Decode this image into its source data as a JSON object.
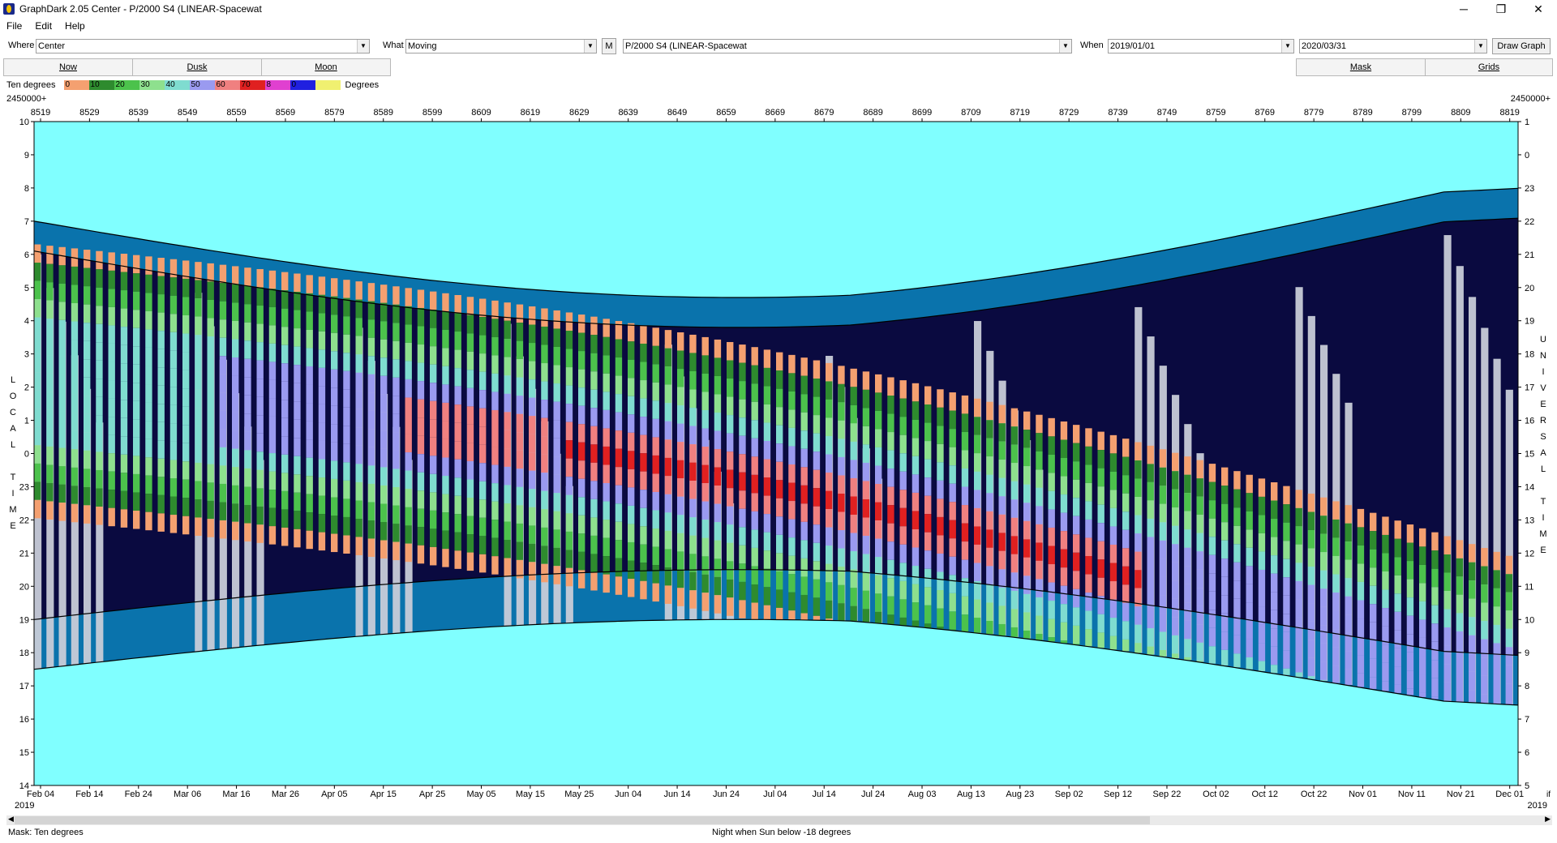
{
  "window": {
    "title": "GraphDark 2.05  Center  -  P/2000 S4 (LINEAR-Spacewat",
    "minimize": "─",
    "maximize": "❐",
    "close": "✕"
  },
  "menu": [
    "File",
    "Edit",
    "Help"
  ],
  "toolbar": {
    "where_label": "Where",
    "where_value": "Center",
    "what_label": "What",
    "what_value": "Moving",
    "m_button": "M",
    "object_value": "P/2000 S4 (LINEAR-Spacewat",
    "when_label": "When",
    "start_date": "2019/01/01",
    "end_date": "2020/03/31",
    "draw_button": "Draw Graph"
  },
  "buttons": {
    "now": "Now",
    "dusk": "Dusk",
    "moon": "Moon",
    "mask": "Mask",
    "grids": "Grids"
  },
  "legend": {
    "title": "Ten degrees",
    "units": "Degrees",
    "entries": [
      {
        "label": "0",
        "color": "#f4a070"
      },
      {
        "label": "10",
        "color": "#2e8b2e"
      },
      {
        "label": "20",
        "color": "#4cc24c"
      },
      {
        "label": "30",
        "color": "#8ee08e"
      },
      {
        "label": "40",
        "color": "#7fdcd0"
      },
      {
        "label": "50",
        "color": "#9a9af0"
      },
      {
        "label": "60",
        "color": "#f08080"
      },
      {
        "label": "70",
        "color": "#e02020"
      },
      {
        "label": "8",
        "color": "#e040d0"
      },
      {
        "label": "0",
        "color": "#2020e0"
      },
      {
        "label": "",
        "color": "#f0f070"
      }
    ]
  },
  "graph": {
    "jd_base_left": "2450000+",
    "jd_base_right": "2450000+",
    "jd_ticks": [
      "8519",
      "8529",
      "8539",
      "8549",
      "8559",
      "8569",
      "8579",
      "8589",
      "8599",
      "8609",
      "8619",
      "8629",
      "8639",
      "8649",
      "8659",
      "8669",
      "8679",
      "8689",
      "8699",
      "8709",
      "8719",
      "8729",
      "8739",
      "8749",
      "8759",
      "8769",
      "8779",
      "8789",
      "8799",
      "8809",
      "8819"
    ],
    "date_ticks": [
      "Feb 04",
      "Feb 14",
      "Feb 24",
      "Mar 06",
      "Mar 16",
      "Mar 26",
      "Apr 05",
      "Apr 15",
      "Apr 25",
      "May 05",
      "May 15",
      "May 25",
      "Jun 04",
      "Jun 14",
      "Jun 24",
      "Jul 04",
      "Jul 14",
      "Jul 24",
      "Aug 03",
      "Aug 13",
      "Aug 23",
      "Sep 02",
      "Sep 12",
      "Sep 22",
      "Oct 02",
      "Oct 12",
      "Oct 22",
      "Nov 01",
      "Nov 11",
      "Nov 21",
      "Dec 01"
    ],
    "year_left": "2019",
    "year_right": "2019",
    "corner_right": "if",
    "left_hours": [
      "10",
      "9",
      "8",
      "7",
      "6",
      "5",
      "4",
      "3",
      "2",
      "1",
      "0",
      "23",
      "22",
      "21",
      "20",
      "19",
      "18",
      "17",
      "16",
      "15",
      "14"
    ],
    "right_hours": [
      "1",
      "0",
      "23",
      "22",
      "21",
      "20",
      "19",
      "18",
      "17",
      "16",
      "15",
      "14",
      "13",
      "12",
      "11",
      "10",
      "9",
      "8",
      "7",
      "6",
      "5"
    ],
    "left_axis_title": [
      "L",
      "O",
      "C",
      "A",
      "L",
      "",
      "T",
      "I",
      "M",
      "E"
    ],
    "right_axis_title": [
      "U",
      "N",
      "I",
      "V",
      "E",
      "R",
      "S",
      "A",
      "L",
      "",
      "T",
      "I",
      "M",
      "E"
    ],
    "colors": {
      "day": "#80ffff",
      "night": "#0a0a40",
      "twilight": "#0a86c0",
      "moon": "#c8ccd8"
    }
  },
  "status": {
    "left": "Mask:  Ten degrees",
    "center": "Night when Sun below -18 degrees"
  }
}
